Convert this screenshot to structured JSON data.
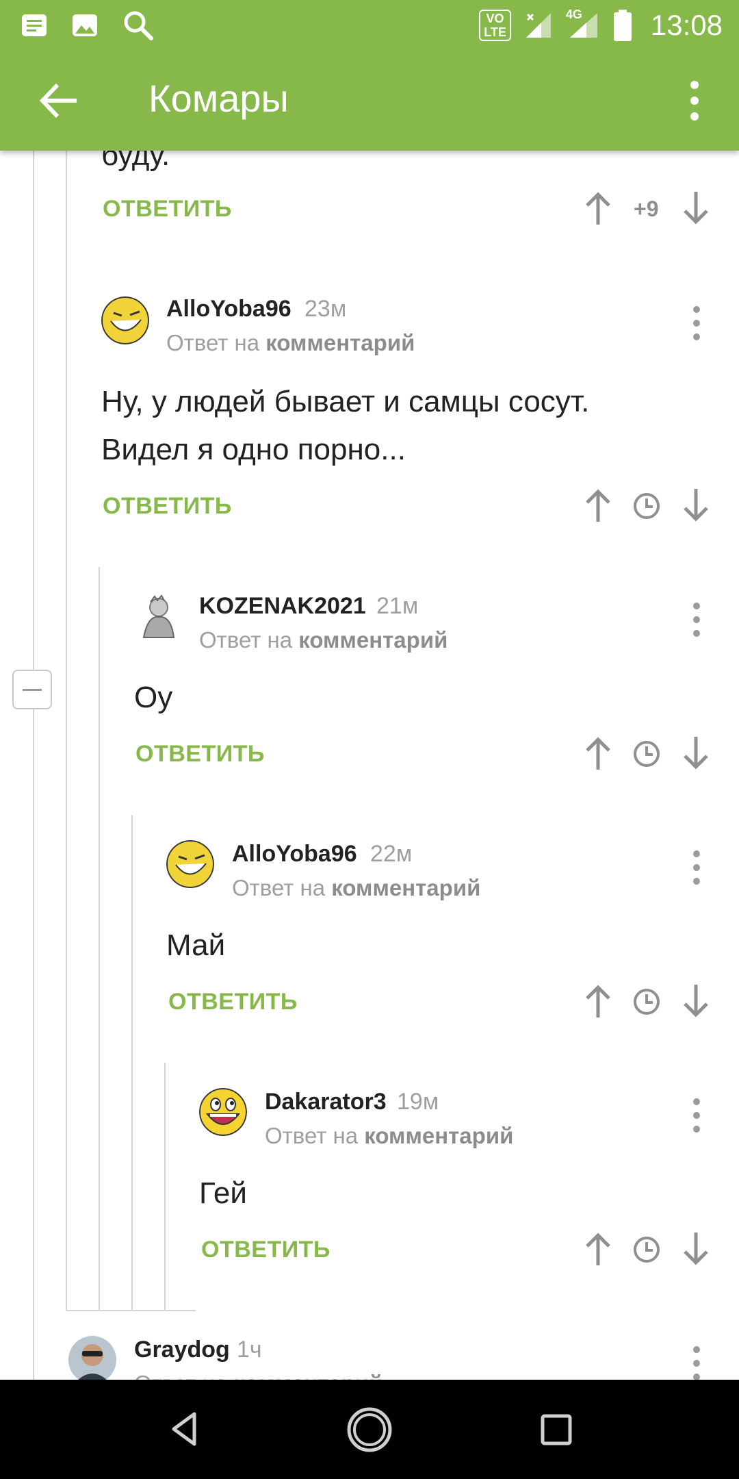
{
  "status_bar": {
    "time": "13:08",
    "network": "4G",
    "volte_top": "VO",
    "volte_bottom": "LTE",
    "icons": [
      "notes-icon",
      "image-icon",
      "search-icon",
      "volte-icon",
      "signal-icon",
      "signal-4g-icon",
      "battery-icon"
    ]
  },
  "toolbar": {
    "title": "Комары",
    "back_icon": "arrow-left-icon",
    "menu_icon": "more-vert-icon"
  },
  "colors": {
    "accent": "#86b84a",
    "muted": "#9e9e9e",
    "text": "#222222"
  },
  "top_partial": {
    "text": "буду.",
    "reply_label": "ОТВЕТИТЬ",
    "score": "+9"
  },
  "comments": [
    {
      "author": "AlloYoba96",
      "time": "23м",
      "reply_prefix": "Ответ на",
      "reply_link": "комментарий",
      "text_lines": [
        "Ну, у людей бывает и самцы сосут.",
        "Видел я одно порно..."
      ],
      "reply_label": "ОТВЕТИТЬ",
      "avatar_icon": "troll-face-avatar"
    },
    {
      "author": "KOZENAK2021",
      "time": "21м",
      "reply_prefix": "Ответ на",
      "reply_link": "комментарий",
      "text_lines": [
        "Оу"
      ],
      "reply_label": "ОТВЕТИТЬ",
      "avatar_icon": "sketch-avatar"
    },
    {
      "author": "AlloYoba96",
      "time": "22м",
      "reply_prefix": "Ответ на",
      "reply_link": "комментарий",
      "text_lines": [
        "Май"
      ],
      "reply_label": "ОТВЕТИТЬ",
      "avatar_icon": "troll-face-avatar"
    },
    {
      "author": "Dakarator3",
      "time": "19м",
      "reply_prefix": "Ответ на",
      "reply_link": "комментарий",
      "text_lines": [
        "Гей"
      ],
      "reply_label": "ОТВЕТИТЬ",
      "avatar_icon": "awesome-face-avatar"
    },
    {
      "author": "Graydog",
      "time": "1ч",
      "reply_prefix": "Ответ на",
      "reply_link": "комментарий",
      "avatar_icon": "photo-avatar"
    }
  ],
  "nav_bar": {
    "icons": [
      "back-triangle-icon",
      "home-circle-icon",
      "recents-square-icon"
    ]
  }
}
